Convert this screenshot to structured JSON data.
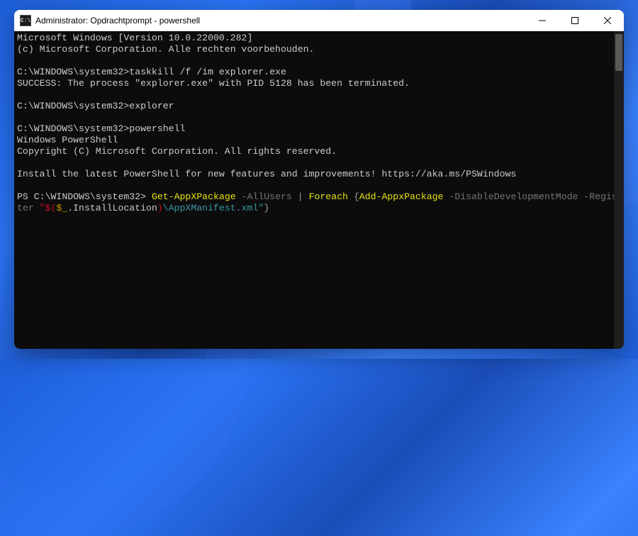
{
  "window": {
    "title": "Administrator: Opdrachtprompt - powershell",
    "icon_text": "C:\\"
  },
  "terminal": {
    "line1": "Microsoft Windows [Version 10.0.22000.282]",
    "line2": "(c) Microsoft Corporation. Alle rechten voorbehouden.",
    "prompt1_path": "C:\\WINDOWS\\system32>",
    "prompt1_cmd": "taskkill /f /im explorer.exe",
    "line4": "SUCCESS: The process \"explorer.exe\" with PID 5128 has been terminated.",
    "prompt2_path": "C:\\WINDOWS\\system32>",
    "prompt2_cmd": "explorer",
    "prompt3_path": "C:\\WINDOWS\\system32>",
    "prompt3_cmd": "powershell",
    "line8": "Windows PowerShell",
    "line9": "Copyright (C) Microsoft Corporation. All rights reserved.",
    "line11": "Install the latest PowerShell for new features and improvements! https://aka.ms/PSWindows",
    "ps_prompt_prefix": "PS ",
    "ps_prompt_path": "C:\\WINDOWS\\system32> ",
    "ps_seg1": "Get-AppXPackage",
    "ps_seg2": " -AllUsers ",
    "ps_seg3": "| ",
    "ps_seg4": "Foreach ",
    "ps_seg5": "{",
    "ps_seg6": "Add-AppxPackage",
    "ps_seg7": " -DisableDevelopmentMode -Register ",
    "ps_seg8": "\"$(",
    "ps_seg9": "$_",
    "ps_seg10": ".InstallLocation",
    "ps_seg11": ")",
    "ps_seg12": "\\AppXManifest.xml\"",
    "ps_seg13": "}"
  }
}
